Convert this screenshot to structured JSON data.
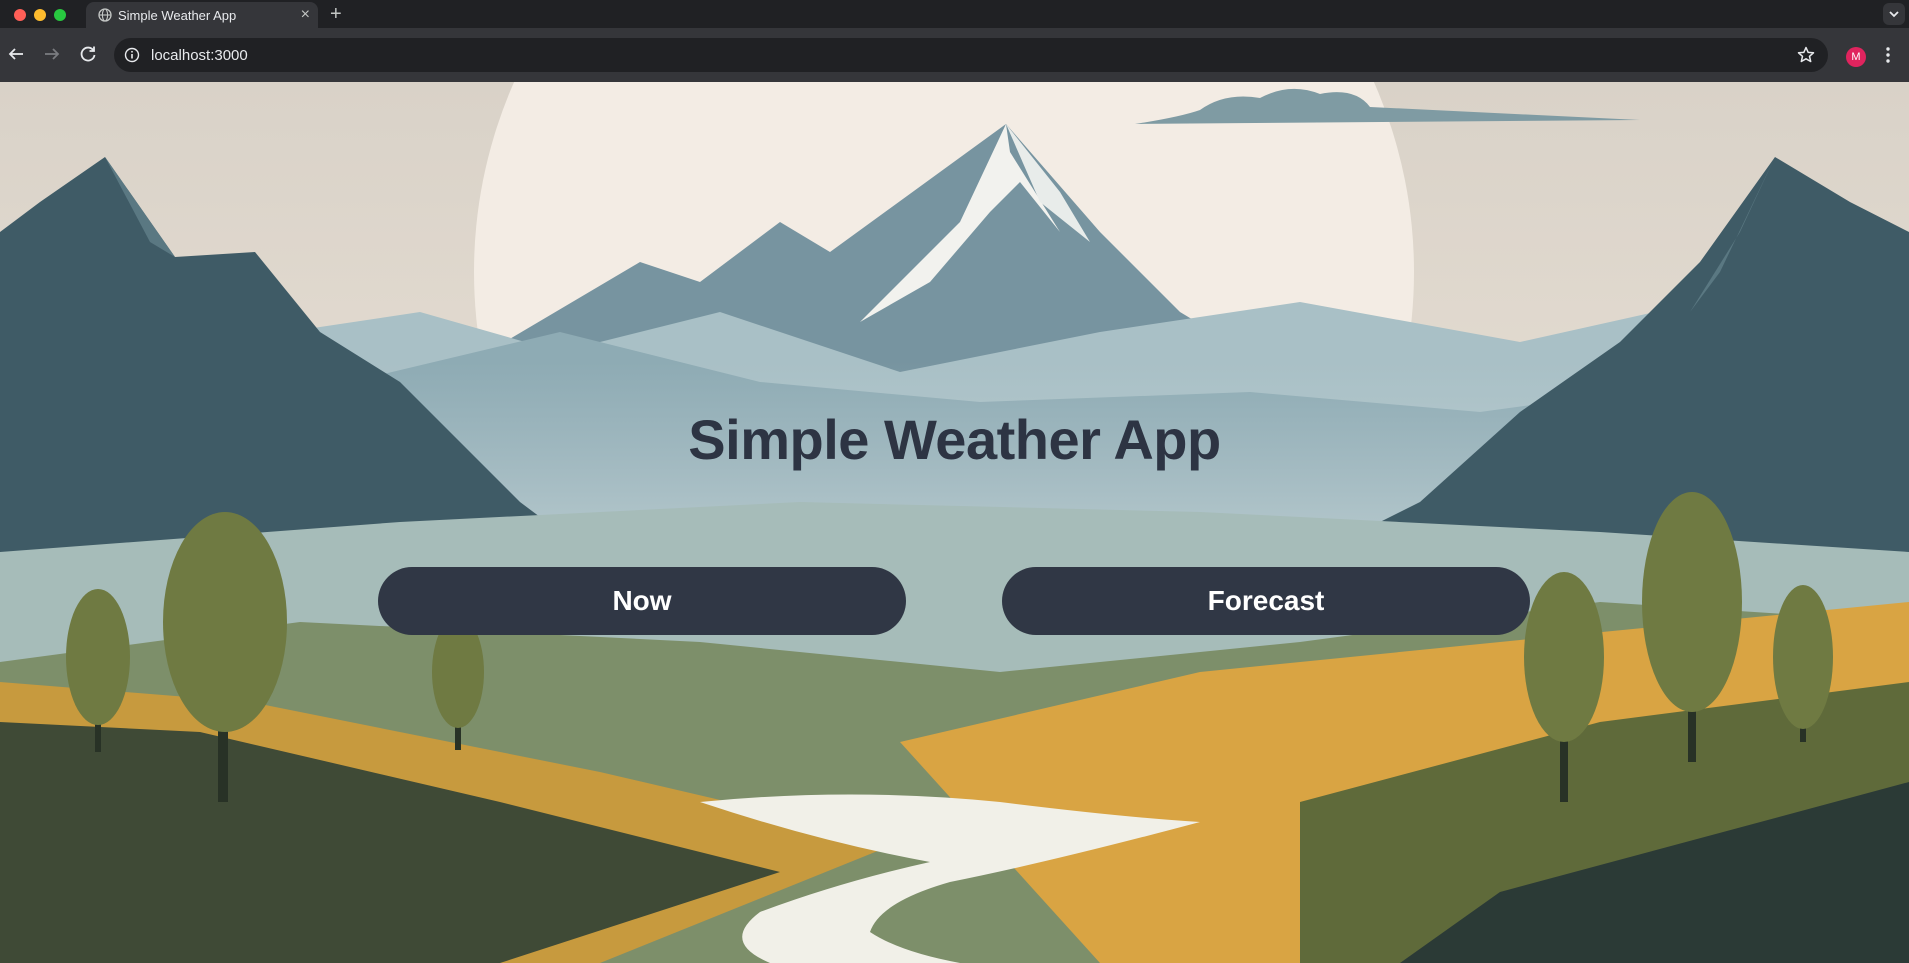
{
  "browser": {
    "tab": {
      "title": "Simple Weather App",
      "favicon": "globe-icon",
      "close": "×"
    },
    "new_tab": "+",
    "url": "localhost:3000",
    "profile_initial": "M",
    "profile_color": "#e0245e"
  },
  "page": {
    "title": "Simple Weather App",
    "buttons": {
      "now": "Now",
      "forecast": "Forecast"
    },
    "colors": {
      "heading": "#2d3443",
      "button_bg": "#303745",
      "button_text": "#ffffff"
    },
    "background": "illustrated mountain landscape"
  }
}
